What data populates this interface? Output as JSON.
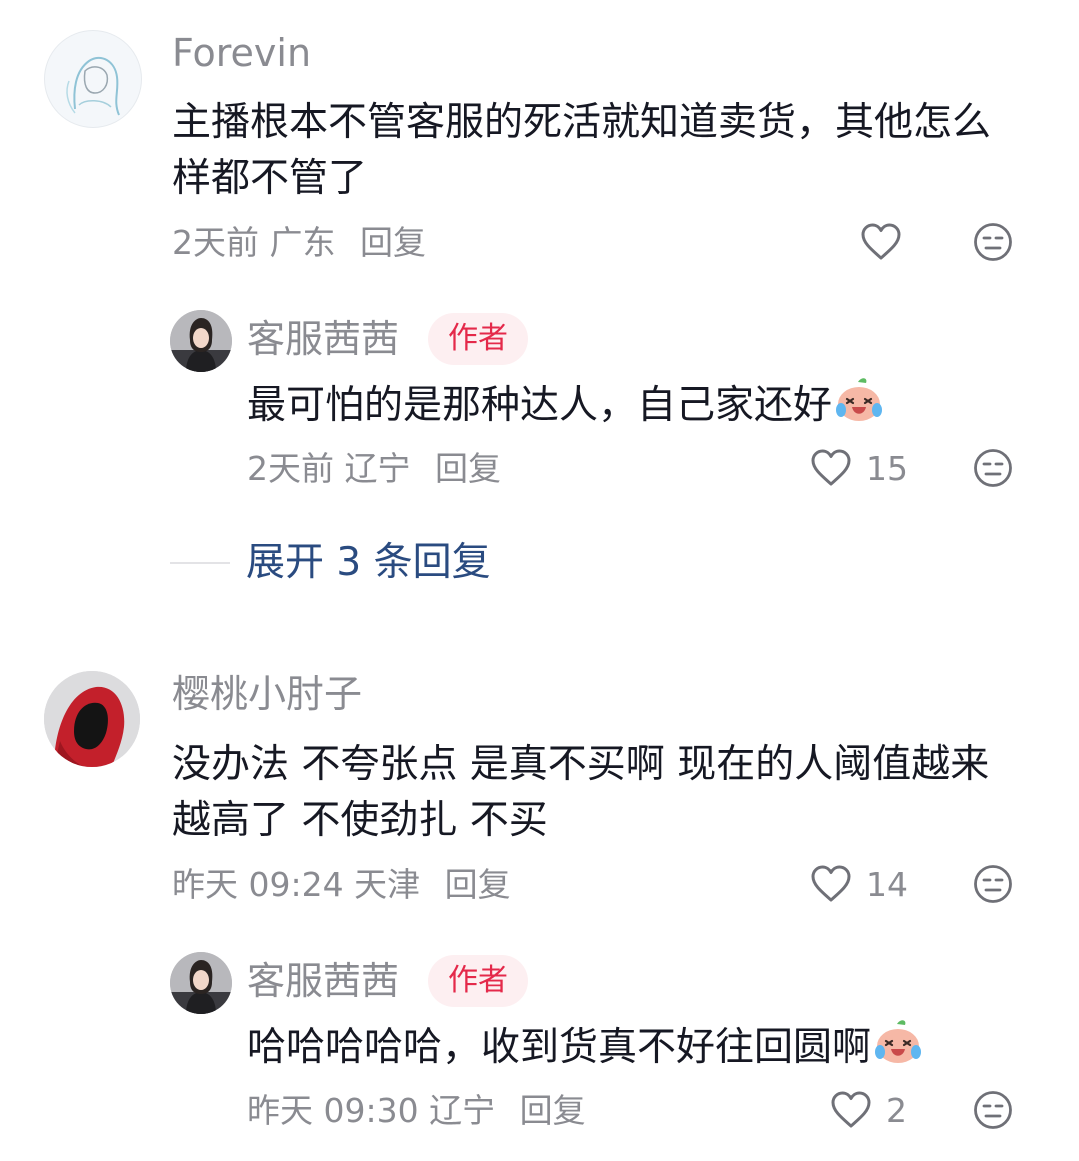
{
  "comments": [
    {
      "username": "Forevin",
      "text": "主播根本不管客服的死活就知道卖货，其他怎么样都不管了",
      "time": "2天前",
      "location": "广东",
      "reply_label": "回复",
      "likes": ""
    },
    {
      "username": "客服茜茜",
      "badge": "作者",
      "text": "最可怕的是那种达人，自己家还好",
      "time": "2天前",
      "location": "辽宁",
      "reply_label": "回复",
      "likes": "15"
    },
    {
      "username": "樱桃小肘子",
      "text": "没办法 不夸张点 是真不买啊 现在的人阈值越来越高了 不使劲扎 不买",
      "time": "昨天 09:24",
      "location": "天津",
      "reply_label": "回复",
      "likes": "14"
    },
    {
      "username": "客服茜茜",
      "badge": "作者",
      "text": "哈哈哈哈哈，收到货真不好往回圆啊",
      "time": "昨天 09:30",
      "location": "辽宁",
      "reply_label": "回复",
      "likes": "2"
    }
  ],
  "expand_replies": {
    "label": "展开 3 条回复"
  },
  "colors": {
    "badge_bg": "#fdeff1",
    "badge_text": "#e4294a",
    "link": "#2a4b80",
    "meta": "#8a8b91"
  },
  "icons": [
    "heart-outline-icon",
    "dislike-face-icon",
    "laughing-crying-emoji-icon"
  ]
}
